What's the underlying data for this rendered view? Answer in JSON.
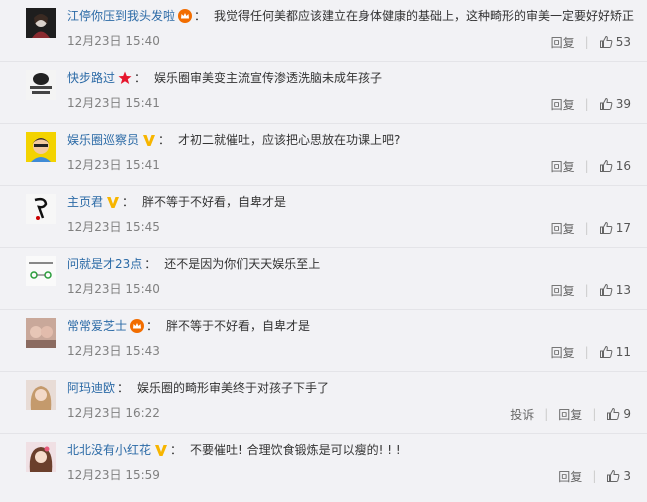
{
  "actions": {
    "reply": "回复",
    "report": "投诉"
  },
  "comments": [
    {
      "user": "江停你压到我头发啦",
      "badge": "crown",
      "text": "我觉得任何美都应该建立在身体健康的基础上，这种畸形的审美一定要好好矫正",
      "time": "12月23日 15:40",
      "likes": "53",
      "report": false
    },
    {
      "user": "快步路过",
      "badge": "star",
      "text": "娱乐圈审美变主流宣传渗透洗脑未成年孩子",
      "time": "12月23日 15:41",
      "likes": "39",
      "report": false
    },
    {
      "user": "娱乐圈巡察员",
      "badge": "v",
      "text": "才初二就催吐，应该把心思放在功课上吧?",
      "time": "12月23日 15:41",
      "likes": "16",
      "report": false
    },
    {
      "user": "主页君",
      "badge": "v",
      "text": "胖不等于不好看，自卑才是",
      "time": "12月23日 15:45",
      "likes": "17",
      "report": false
    },
    {
      "user": "问就是才23点",
      "badge": "",
      "text": "还不是因为你们天天娱乐至上",
      "time": "12月23日 15:40",
      "likes": "13",
      "report": false
    },
    {
      "user": "常常爱芝士",
      "badge": "crown",
      "text": "胖不等于不好看，自卑才是",
      "time": "12月23日 15:43",
      "likes": "11",
      "report": false
    },
    {
      "user": "阿玛迪欧",
      "badge": "",
      "text": "娱乐圈的畸形审美终于对孩子下手了",
      "time": "12月23日 16:22",
      "likes": "9",
      "report": true
    },
    {
      "user": "北北没有小红花",
      "badge": "v",
      "text": "不要催吐! 合理饮食锻炼是可以瘦的! ! !",
      "time": "12月23日 15:59",
      "likes": "3",
      "report": false
    }
  ],
  "colors": {
    "username": "#2b6aa6",
    "badge_v": "#f7b500",
    "badge_crown": "#f26d00",
    "badge_star": "#e6162d"
  },
  "icons": {
    "like": "thumbs-up-icon"
  }
}
